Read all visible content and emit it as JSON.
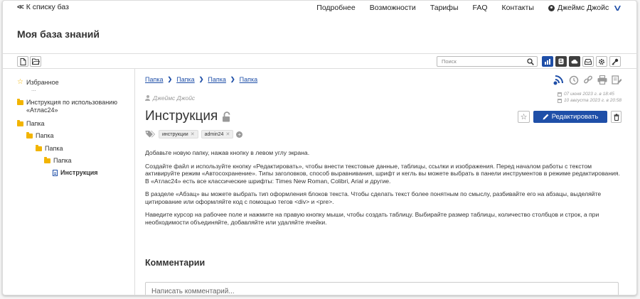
{
  "topbar": {
    "back_label": "К списку баз",
    "nav": [
      "Подробнее",
      "Возможности",
      "Тарифы",
      "FAQ",
      "Контакты"
    ],
    "user_name": "Джеймс Джойс"
  },
  "page_title": "Моя база знаний",
  "search": {
    "placeholder": "Поиск"
  },
  "sidebar": {
    "favorites": "Избранное",
    "ellipsis": "...",
    "items": [
      {
        "label": "Инструкция по использованию «Атлас24»",
        "type": "folder"
      },
      {
        "label": "Папка",
        "type": "folder"
      },
      {
        "label": "Папка",
        "type": "folder"
      },
      {
        "label": "Папка",
        "type": "folder"
      },
      {
        "label": "Папка",
        "type": "folder"
      },
      {
        "label": "Инструкция",
        "type": "document"
      }
    ]
  },
  "breadcrumb": [
    "Папка",
    "Папка",
    "Папка",
    "Папка"
  ],
  "document": {
    "author": "Джеймс Джойс",
    "title": "Инструкция",
    "created": "07 июня 2023 г. в 18:45",
    "updated": "10 августа 2023 г. в 20:58",
    "tags": [
      "инструкции",
      "admin24"
    ],
    "edit_label": "Редактировать",
    "paragraphs": [
      "Добавьте новую папку, нажав кнопку в левом углу экрана.",
      "Создайте файл и используйте кнопку «Редактировать», чтобы внести текстовые данные, таблицы, ссылки и изображения. Перед началом работы с текстом активируйте режим «Автосохранение». Типы заголовков, способ выравнивания, шрифт и кегль вы можете выбрать в панели инструментов в режиме редактирования. В «Атлас24» есть все классические шрифты: Times New Roman, Colibri, Arial и другие.",
      "В разделе «Абзац» вы можете выбрать тип оформления блоков текста. Чтобы сделать текст более понятным по смыслу, разбивайте его на абзацы, выделяйте цитирование или оформляйте код с помощью тегов <div> и <pre>.",
      "Наведите курсор на рабочее поле и нажмите на правую кнопку мыши, чтобы создать таблицу. Выбирайте размер таблицы, количество столбцов и строк, а при необходимости объединяйте, добавляйте или удаляйте ячейки."
    ]
  },
  "comments": {
    "title": "Комментарии",
    "placeholder": "Написать комментарий..."
  },
  "colors": {
    "accent": "#1f4fa8",
    "folder": "#f2b400"
  }
}
